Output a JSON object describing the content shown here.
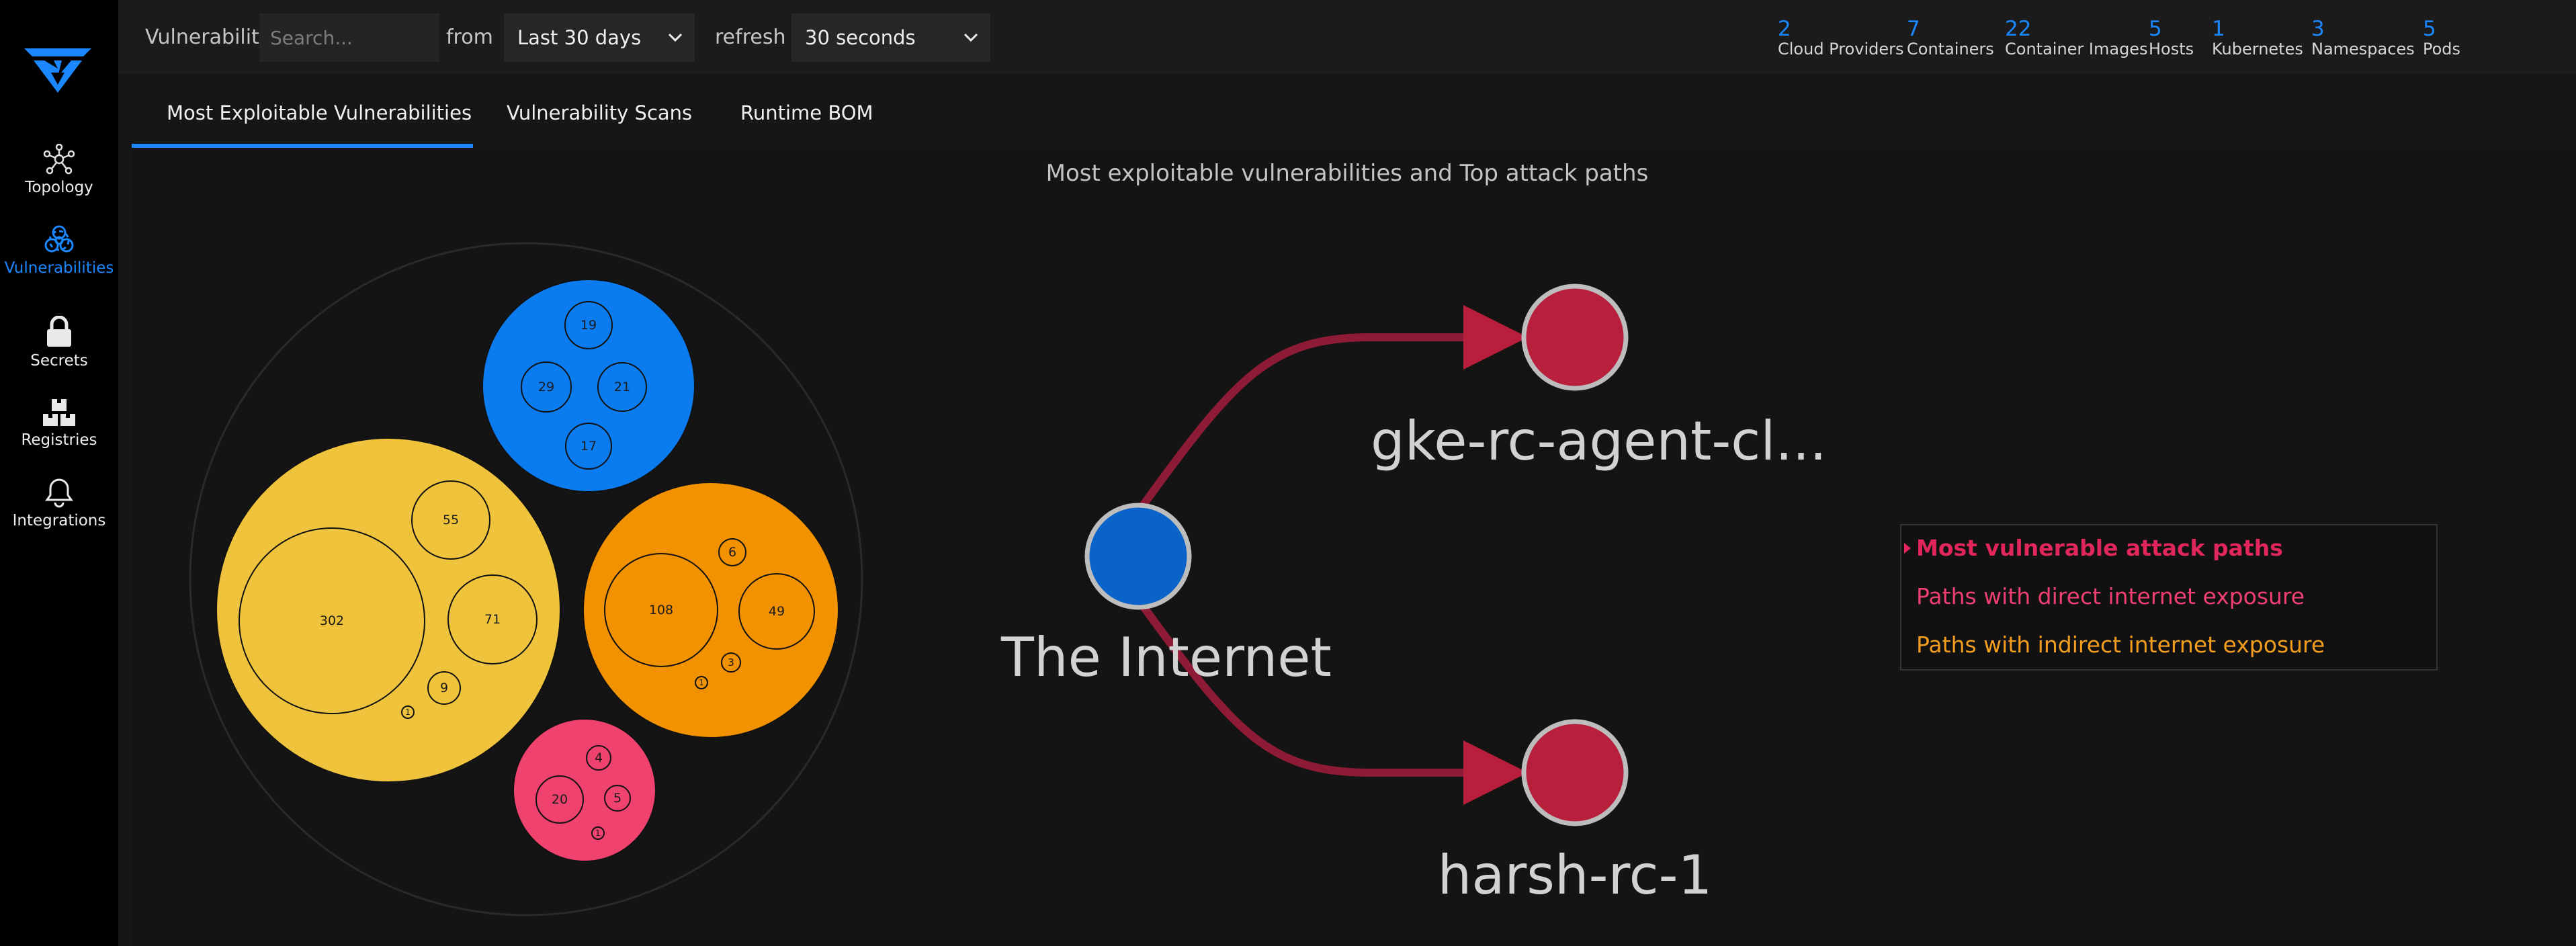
{
  "sidebar": {
    "items": [
      {
        "label": "Topology",
        "icon": "topology-icon"
      },
      {
        "label": "Vulnerabilities",
        "icon": "biohazard-icon",
        "active": true
      },
      {
        "label": "Secrets",
        "icon": "lock-icon"
      },
      {
        "label": "Registries",
        "icon": "registries-icon"
      },
      {
        "label": "Integrations",
        "icon": "bell-icon"
      }
    ]
  },
  "topbar": {
    "vulnerability_label": "Vulnerability",
    "search_placeholder": "Search...",
    "from_label": "from",
    "time_range": "Last 30 days",
    "refresh_label": "refresh",
    "refresh_interval": "30 seconds",
    "stats": [
      {
        "value": "2",
        "label": "Cloud Providers"
      },
      {
        "value": "7",
        "label": "Containers"
      },
      {
        "value": "22",
        "label": "Container Images"
      },
      {
        "value": "5",
        "label": "Hosts"
      },
      {
        "value": "1",
        "label": "Kubernetes"
      },
      {
        "value": "3",
        "label": "Namespaces"
      },
      {
        "value": "5",
        "label": "Pods"
      }
    ]
  },
  "tabs": [
    {
      "label": "Most Exploitable Vulnerabilities",
      "active": true
    },
    {
      "label": "Vulnerability Scans"
    },
    {
      "label": "Runtime BOM"
    }
  ],
  "main": {
    "subtitle": "Most exploitable vulnerabilities and Top attack paths",
    "bubbles": {
      "groups": [
        {
          "severity": "low",
          "color": "#0a7cf0",
          "values": [
            "19",
            "29",
            "21",
            "17"
          ]
        },
        {
          "severity": "medium",
          "color": "#f0c33c",
          "values": [
            "302",
            "55",
            "71",
            "9",
            "1"
          ]
        },
        {
          "severity": "high",
          "color": "#f39200",
          "values": [
            "108",
            "49",
            "6",
            "3",
            "1"
          ]
        },
        {
          "severity": "critical",
          "color": "#f0426f",
          "values": [
            "20",
            "4",
            "5",
            "1"
          ]
        }
      ]
    },
    "attack_graph": {
      "nodes": [
        {
          "label": "The Internet",
          "color": "#0a63c8"
        },
        {
          "label": "gke-rc-agent-cl...",
          "color": "#b81f3d"
        },
        {
          "label": "harsh-rc-1",
          "color": "#b81f3d"
        }
      ],
      "edge_color": "#8e1b35"
    },
    "legend": [
      {
        "label": "Most vulnerable attack paths",
        "color": "#e0265a",
        "bold": true
      },
      {
        "label": "Paths with direct internet exposure",
        "color": "#ef3f73"
      },
      {
        "label": "Paths with indirect internet exposure",
        "color": "#f29d1d"
      }
    ]
  }
}
